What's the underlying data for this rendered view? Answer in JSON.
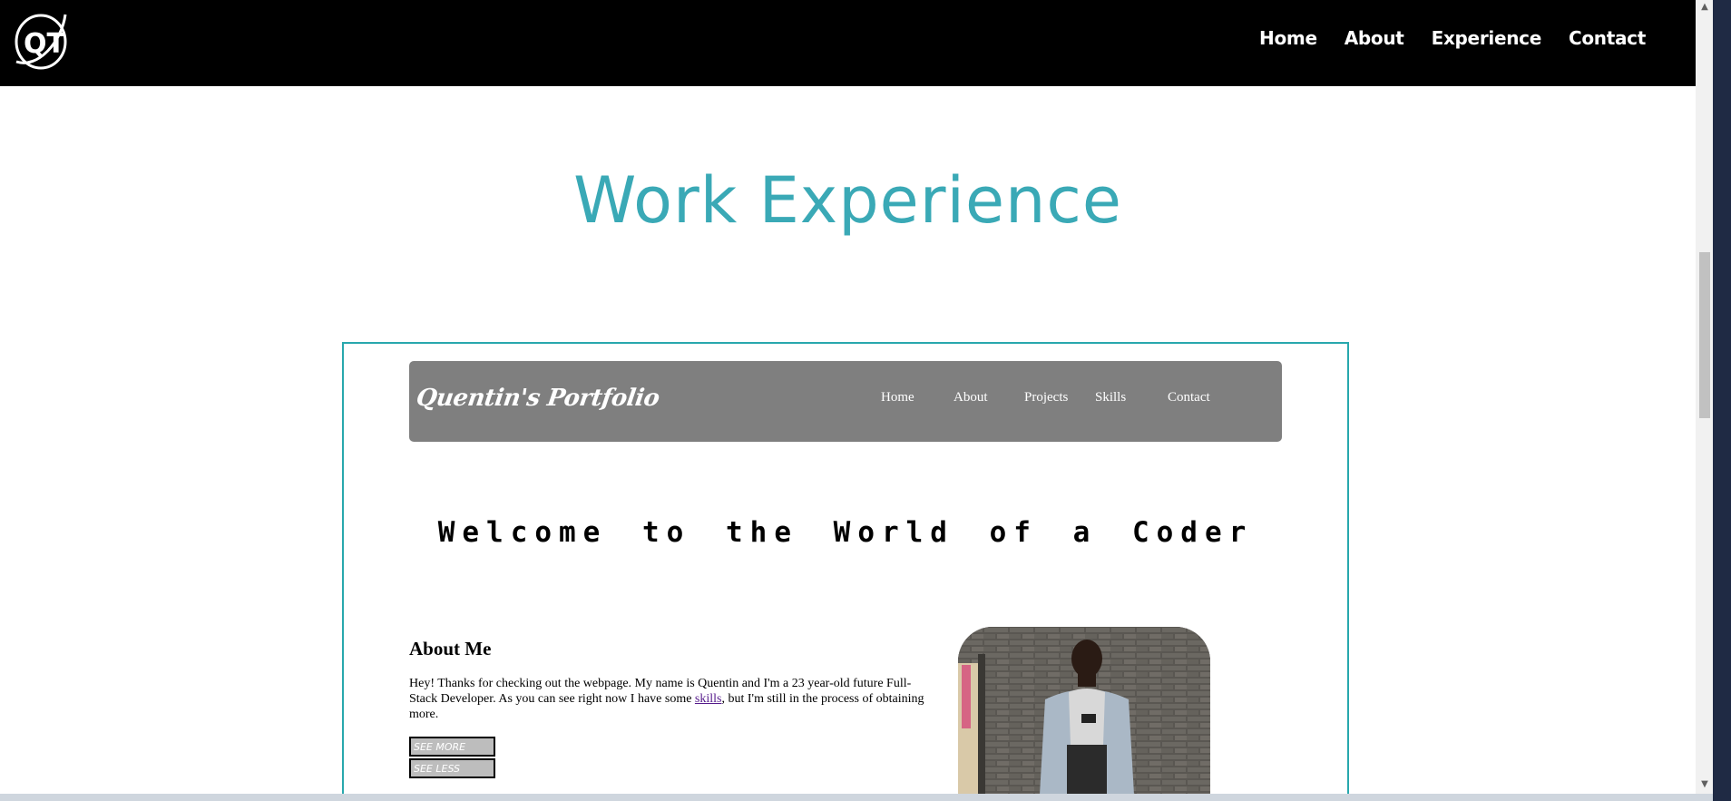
{
  "header": {
    "logo_icon": "qt-monogram-logo",
    "nav": [
      "Home",
      "About",
      "Experience",
      "Contact"
    ]
  },
  "section_title": "Work Experience",
  "preview": {
    "brand": "Quentin's Portfolio",
    "nav": [
      "Home",
      "About",
      "Projects",
      "Skills",
      "Contact"
    ],
    "welcome": "Welcome to the World of a Coder",
    "about_title": "About Me",
    "about_text_before": "Hey! Thanks for checking out the webpage. My name is Quentin and I'm a 23 year-old future Full-Stack Developer. As you can see right now I have some ",
    "about_link": "skills",
    "about_text_after": ", but I'm still in the process of obtaining more.",
    "see_more": "SEE MORE",
    "see_less": "SEE LESS",
    "photo": "person-portrait-photo"
  }
}
